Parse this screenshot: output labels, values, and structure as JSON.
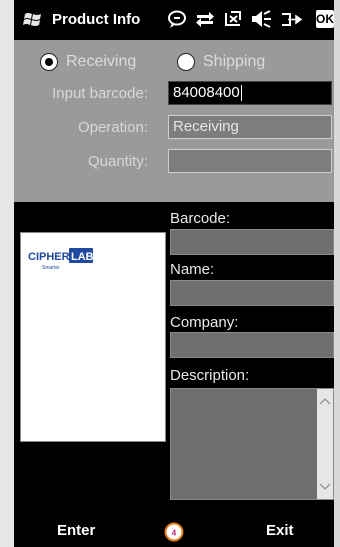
{
  "titlebar": {
    "title": "Product Info",
    "ok_label": "OK"
  },
  "form": {
    "receiving_label": "Receiving",
    "shipping_label": "Shipping",
    "selected_mode": "Receiving",
    "input_barcode_label": "Input barcode:",
    "input_barcode_value": "84008400",
    "operation_label": "Operation:",
    "operation_value": "Receiving",
    "quantity_label": "Quantity:",
    "quantity_value": ""
  },
  "details": {
    "barcode_label": "Barcode:",
    "name_label": "Name:",
    "company_label": "Company:",
    "description_label": "Description:"
  },
  "logo": {
    "text_left": "CIPHER",
    "text_right": "LAB",
    "tagline": "Smarter"
  },
  "softkeys": {
    "left": "Enter",
    "right": "Exit"
  },
  "colors": {
    "panel_gray": "#9a9a9a",
    "field_gray": "#6f6f6f",
    "logo_blue": "#1f4aa0"
  }
}
